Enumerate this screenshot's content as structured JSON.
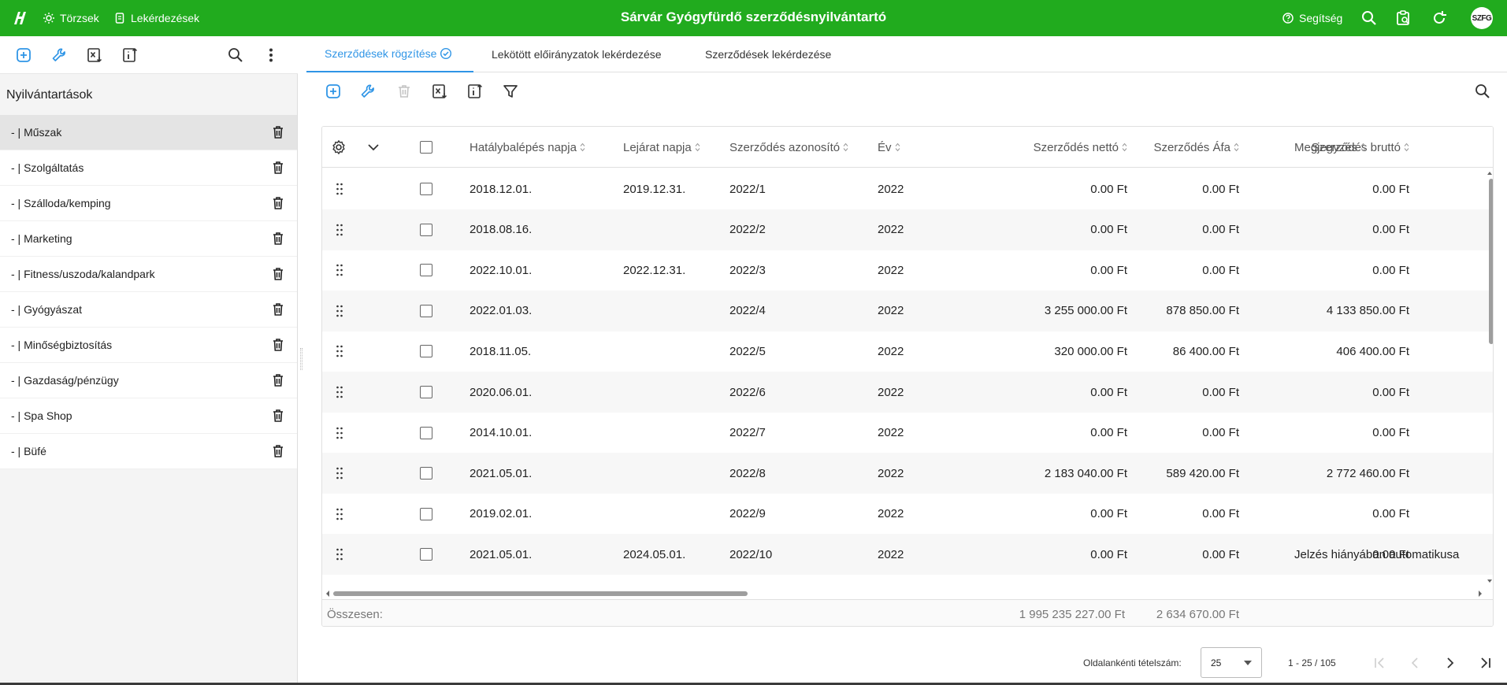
{
  "app": {
    "title": "Sárvár Gyógyfürdő szerződésnyilvántartó",
    "nav": [
      {
        "label": "Törzsek",
        "icon": "sun-gear-icon"
      },
      {
        "label": "Lekérdezések",
        "icon": "document-icon"
      }
    ],
    "help_label": "Segítség",
    "avatar_initials": "SZFG",
    "accent_color": "#21ab1e",
    "link_color": "#2f95e6"
  },
  "left_panel": {
    "title": "Nyilvántartások",
    "toolbar": [
      "add-icon",
      "wrench-icon",
      "excel-export-icon",
      "info-export-icon",
      "search-icon",
      "more-vert-icon"
    ],
    "items": [
      {
        "label": "- | Műszak",
        "active": true
      },
      {
        "label": "- | Szolgáltatás"
      },
      {
        "label": "- | Szálloda/kemping"
      },
      {
        "label": "- | Marketing"
      },
      {
        "label": "- | Fitness/uszoda/kalandpark"
      },
      {
        "label": "- | Gyógyászat"
      },
      {
        "label": "- | Minőségbiztosítás"
      },
      {
        "label": "- | Gazdaság/pénzügy"
      },
      {
        "label": "- | Spa Shop"
      },
      {
        "label": "- | Büfé"
      }
    ]
  },
  "tabs": [
    {
      "label": "Szerződések rögzítése",
      "active": true
    },
    {
      "label": "Lekötött előirányzatok lekérdezése"
    },
    {
      "label": "Szerződések lekérdezése"
    }
  ],
  "grid": {
    "columns": [
      "Hatálybalépés napja",
      "Lejárat napja",
      "Szerződés azonosító",
      "Év",
      "Szerződés nettó",
      "Szerződés Áfa",
      "Szerződés bruttó",
      "Megjegyzés"
    ],
    "rows": [
      [
        "2018.12.01.",
        "2019.12.31.",
        "2022/1",
        "2022",
        "0.00 Ft",
        "0.00 Ft",
        "0.00 Ft",
        ""
      ],
      [
        "2018.08.16.",
        "",
        "2022/2",
        "2022",
        "0.00 Ft",
        "0.00 Ft",
        "0.00 Ft",
        ""
      ],
      [
        "2022.10.01.",
        "2022.12.31.",
        "2022/3",
        "2022",
        "0.00 Ft",
        "0.00 Ft",
        "0.00 Ft",
        ""
      ],
      [
        "2022.01.03.",
        "",
        "2022/4",
        "2022",
        "3 255 000.00 Ft",
        "878 850.00 Ft",
        "4 133 850.00 Ft",
        ""
      ],
      [
        "2018.11.05.",
        "",
        "2022/5",
        "2022",
        "320 000.00 Ft",
        "86 400.00 Ft",
        "406 400.00 Ft",
        ""
      ],
      [
        "2020.06.01.",
        "",
        "2022/6",
        "2022",
        "0.00 Ft",
        "0.00 Ft",
        "0.00 Ft",
        ""
      ],
      [
        "2014.10.01.",
        "",
        "2022/7",
        "2022",
        "0.00 Ft",
        "0.00 Ft",
        "0.00 Ft",
        ""
      ],
      [
        "2021.05.01.",
        "",
        "2022/8",
        "2022",
        "2 183 040.00 Ft",
        "589 420.00 Ft",
        "2 772 460.00 Ft",
        ""
      ],
      [
        "2019.02.01.",
        "",
        "2022/9",
        "2022",
        "0.00 Ft",
        "0.00 Ft",
        "0.00 Ft",
        ""
      ],
      [
        "2021.05.01.",
        "2024.05.01.",
        "2022/10",
        "2022",
        "0.00 Ft",
        "0.00 Ft",
        "0.00 Ft",
        "Jelzés hiányában automatikusa"
      ]
    ],
    "footer": {
      "label": "Összesen:",
      "netto_total": "1 995 235 227.00 Ft",
      "afa_total": "2 634 670.00 Ft"
    }
  },
  "pager": {
    "page_size_label": "Oldalankénti tételszám:",
    "page_size": "25",
    "range": "1 - 25 / 105"
  }
}
